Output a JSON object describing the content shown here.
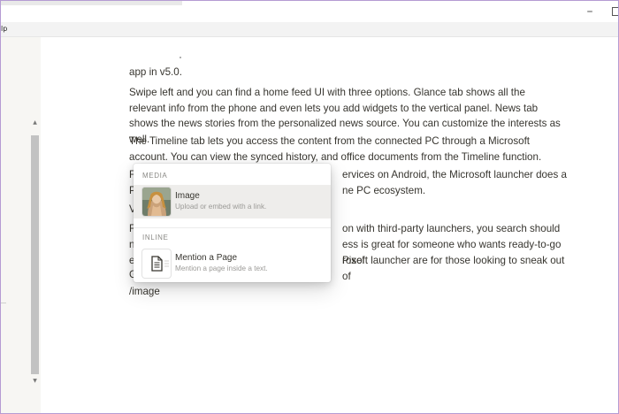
{
  "window": {
    "menu_help": "lp",
    "minimize_label": "–"
  },
  "scrollbar": {
    "up": "▲",
    "down": "▼"
  },
  "document": {
    "para_intro": "app in v5.0.",
    "para_swipe": "Swipe left and you can find a home feed UI with three options. Glance tab shows all the relevant info from the phone and even lets you add widgets to the vertical panel. News tab shows the news stories from the personalized news source. You can customize the interests as well.",
    "para_timeline": "The Timeline tab lets you access the content from the connected PC through a Microsoft account. You can view the synced history, and office documents from the Timeline function.",
    "para4_left": "F",
    "para4_right": "ervices on Android, the Microsoft launcher does a",
    "para5_left": "P",
    "para5_right": "ne PC ecosystem.",
    "para6_left": "V",
    "para7_left": "F",
    "para7_right": "on with third-party launchers, you search should",
    "para8_left": "n",
    "para8_right": "ess is great for someone who wants ready-to-go Pixel",
    "para9_left": "e",
    "para9_right": "rosoft launcher are for those looking to sneak out of",
    "para10_left": "G",
    "slash_command": "/image"
  },
  "popup": {
    "media_section": "MEDIA",
    "image_title": "Image",
    "image_desc": "Upload or embed with a link.",
    "inline_section": "INLINE",
    "mention_title": "Mention a Page",
    "mention_desc": "Mention a page inside a text."
  },
  "colors": {
    "window_border": "#b59bd3",
    "sidebar_bg": "#f7f6f3",
    "text": "#37352f",
    "muted": "#9b9a97",
    "selected_bg": "#eeedeb"
  },
  "icons": [
    "image-thumbnail-icon",
    "page-icon"
  ]
}
